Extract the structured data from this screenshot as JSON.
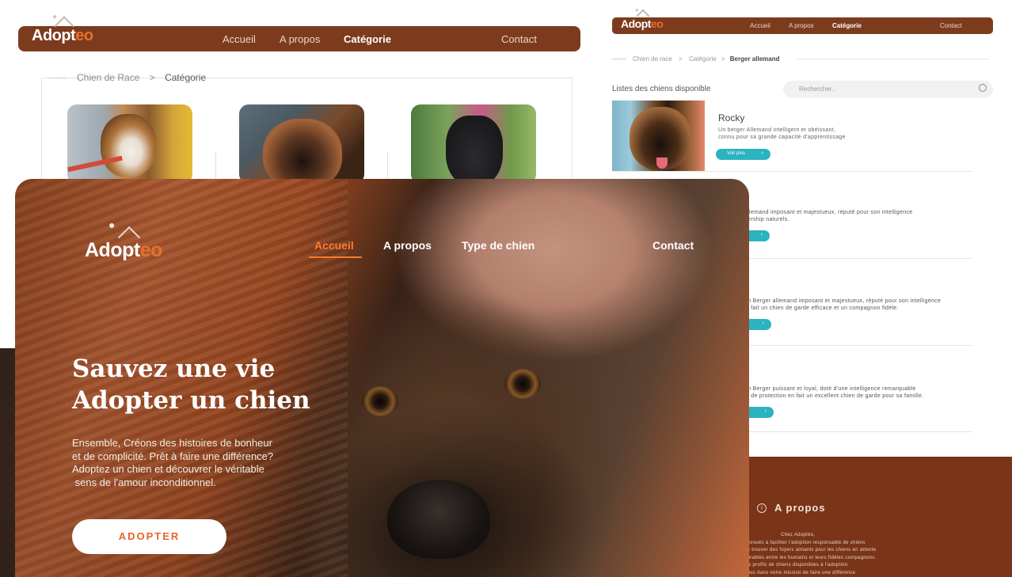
{
  "brand": {
    "name_main": "Adopt",
    "name_accent": "eo",
    "accent": "#e8702a",
    "primary": "#7d3b1e",
    "teal": "#2bb3c0"
  },
  "category_page": {
    "nav": [
      "Accueil",
      "A propos",
      "Catégorie",
      "Contact"
    ],
    "active": "Catégorie",
    "breadcrumb": {
      "parent": "Chien de Race",
      "sep": ">",
      "current": "Catégorie"
    }
  },
  "list_page": {
    "nav": [
      "Accueil",
      "A propos",
      "Catégorie",
      "Contact"
    ],
    "breadcrumb": {
      "a": "Chien de race",
      "b": "Catégorie",
      "c": "Berger allemand",
      "sep": ">"
    },
    "list_title": "Listes des chiens disponible",
    "search_placeholder": "Rechercher..",
    "first_item": {
      "name": "Rocky",
      "desc_line1": "Un berger Allemand intelligent et obéissant,",
      "desc_line2": "connu pour sa grande capacité d'apprentissage",
      "button": "Voir plus"
    },
    "partial_items": [
      {
        "line1": "allemand imposant et majestueux, réputé pour son intelligence",
        "line2": "dership naturels."
      },
      {
        "line1": "un Berger allemand imposant et majestueux, réputé pour son intelligence",
        "line2": "le fait un chien de garde efficace et un compagnon fidèle."
      },
      {
        "line1": "un Berger puissant et loyal, doté d'une intelligence remarquable",
        "line2": "ct de protection en fait un excellent chien de garde pour sa famille."
      }
    ],
    "footer": {
      "title": "A propos",
      "lines": [
        "Chez Adoptéo,",
        "dévoués à faciliter l'adoption responsable de chiens",
        "de trouver des foyers aimants pour les chiens en attente",
        "durables entre les humains et leurs fidèles compagnons.",
        "les profils de chiens disponibles à l'adoption",
        "nous dans notre mission de faire une différence"
      ]
    }
  },
  "hero": {
    "nav": [
      "Accueil",
      "A propos",
      "Type de chien",
      "Contact"
    ],
    "active": "Accueil",
    "headline_1": "Sauvez une vie",
    "headline_2": "Adopter un chien",
    "sub_1": "Ensemble, Créons des histoires de bonheur",
    "sub_2": "et de complicité. Prêt à faire une différence?",
    "sub_3": "Adoptez un chien et découvrer le véritable",
    "sub_4": " sens de l'amour inconditionnel.",
    "cta": "ADOPTER"
  }
}
